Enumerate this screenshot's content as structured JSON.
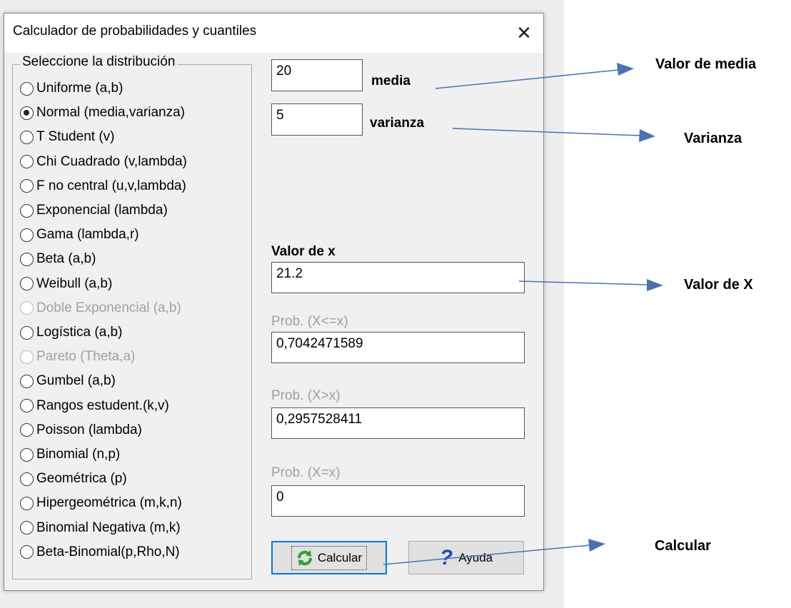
{
  "window": {
    "title": "Calculador de probabilidades y cuantiles",
    "close_symbol": "✕"
  },
  "distribution_group": {
    "label": "Seleccione la distribución",
    "options": [
      {
        "label": "Uniforme (a,b)",
        "selected": false,
        "enabled": true
      },
      {
        "label": "Normal (media,varianza)",
        "selected": true,
        "enabled": true
      },
      {
        "label": "T Student (v)",
        "selected": false,
        "enabled": true
      },
      {
        "label": "Chi Cuadrado (v,lambda)",
        "selected": false,
        "enabled": true
      },
      {
        "label": "F no central (u,v,lambda)",
        "selected": false,
        "enabled": true
      },
      {
        "label": "Exponencial (lambda)",
        "selected": false,
        "enabled": true
      },
      {
        "label": "Gama (lambda,r)",
        "selected": false,
        "enabled": true
      },
      {
        "label": "Beta (a,b)",
        "selected": false,
        "enabled": true
      },
      {
        "label": "Weibull (a,b)",
        "selected": false,
        "enabled": true
      },
      {
        "label": "Doble Exponencial (a,b)",
        "selected": false,
        "enabled": false
      },
      {
        "label": "Logística (a,b)",
        "selected": false,
        "enabled": true
      },
      {
        "label": "Pareto (Theta,a)",
        "selected": false,
        "enabled": false
      },
      {
        "label": "Gumbel (a,b)",
        "selected": false,
        "enabled": true
      },
      {
        "label": "Rangos estudent.(k,v)",
        "selected": false,
        "enabled": true
      },
      {
        "label": "Poisson (lambda)",
        "selected": false,
        "enabled": true
      },
      {
        "label": "Binomial (n,p)",
        "selected": false,
        "enabled": true
      },
      {
        "label": "Geométrica (p)",
        "selected": false,
        "enabled": true
      },
      {
        "label": "Hipergeométrica (m,k,n)",
        "selected": false,
        "enabled": true
      },
      {
        "label": "Binomial Negativa (m,k)",
        "selected": false,
        "enabled": true
      },
      {
        "label": "Beta-Binomial(p,Rho,N)",
        "selected": false,
        "enabled": true
      }
    ]
  },
  "params": {
    "media_value": "20",
    "media_label": "media",
    "varianza_value": "5",
    "varianza_label": "varianza"
  },
  "x_field": {
    "label": "Valor de x",
    "value": "21.2"
  },
  "prob_le": {
    "label": "Prob. (X<=x)",
    "value": "0,7042471589"
  },
  "prob_gt": {
    "label": "Prob. (X>x)",
    "value": "0,2957528411"
  },
  "prob_eq": {
    "label": "Prob. (X=x)",
    "value": "0"
  },
  "buttons": {
    "calcular": "Calcular",
    "ayuda": "Ayuda"
  },
  "annotations": {
    "media": "Valor de media",
    "varianza": "Varianza",
    "x": "Valor de X",
    "calcular": "Calcular"
  },
  "colors": {
    "arrow": "#4a72b0",
    "focus_border": "#0078d7",
    "refresh_icon": "#2e9e2e",
    "help_icon": "#1f4fb5"
  }
}
